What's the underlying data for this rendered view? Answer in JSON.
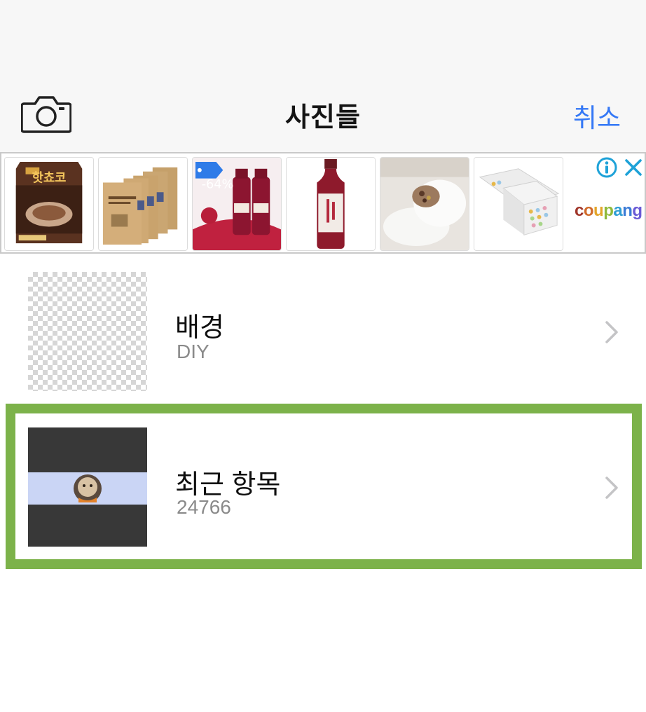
{
  "navbar": {
    "title": "사진들",
    "cancel_label": "취소",
    "camera_icon": "camera-icon"
  },
  "ad": {
    "brand": "coupang",
    "products": [
      {
        "label": "핫쵸코",
        "icon": "product-hot-chocolate"
      },
      {
        "label": "",
        "icon": "product-kraft-bags"
      },
      {
        "label": "-64%",
        "icon": "product-pomegranate-juice"
      },
      {
        "label": "",
        "icon": "product-juice-bottle"
      },
      {
        "label": "",
        "icon": "product-rice-cake"
      },
      {
        "label": "",
        "icon": "product-gift-box"
      }
    ],
    "info_icon": "info-icon",
    "close_icon": "close-icon"
  },
  "albums": [
    {
      "name": "배경",
      "count": "DIY",
      "thumbnail": "transparent-checker"
    },
    {
      "name": "최근 항목",
      "count": "24766",
      "thumbnail": "dog-photo",
      "highlighted": true
    }
  ],
  "colors": {
    "accent": "#3478f6",
    "highlight": "#7cb24a",
    "navbar_bg": "#f7f7f7",
    "secondary_text": "#8a8a8a"
  }
}
